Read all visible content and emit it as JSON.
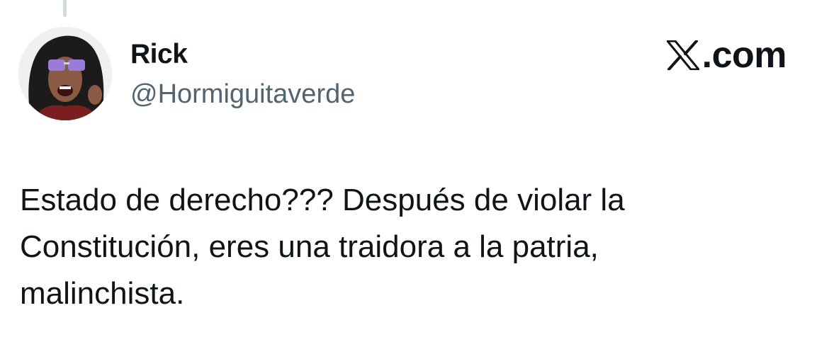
{
  "author": {
    "display_name": "Rick",
    "handle": "@Hormiguitaverde",
    "avatar": "profile-photo"
  },
  "brand": {
    "icon": "x-logo-icon",
    "label": ".com"
  },
  "tweet": {
    "lines": [
      "Estado de derecho??? Después de violar la",
      "Constitución, eres una traidora a la patria,",
      "malinchista."
    ]
  },
  "colors": {
    "text_primary": "#0f1419",
    "text_secondary": "#536471",
    "thread_line": "#cfd9de",
    "background": "#ffffff"
  }
}
